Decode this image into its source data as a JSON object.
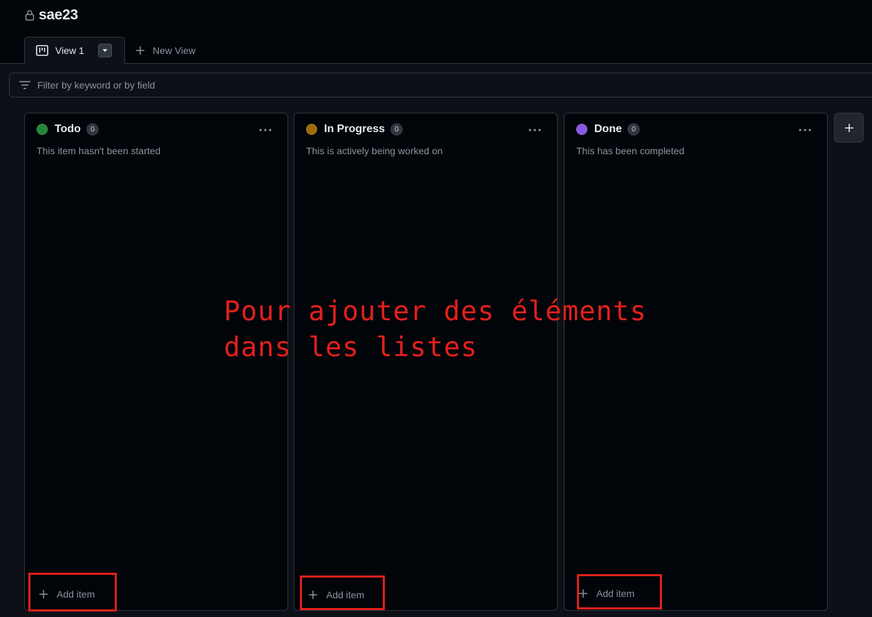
{
  "project": {
    "title": "sae23",
    "lock_icon": "lock-icon"
  },
  "tabs": {
    "active_label": "View 1",
    "active_icon": "board-icon",
    "new_label": "New View"
  },
  "filter": {
    "placeholder": "Filter by keyword or by field",
    "icon": "filter-icon"
  },
  "columns": [
    {
      "name": "Todo",
      "count": "0",
      "color": "#238636",
      "description": "This item hasn't been started",
      "add_label": "Add item"
    },
    {
      "name": "In Progress",
      "count": "0",
      "color": "#9e6a03",
      "description": "This is actively being worked on",
      "add_label": "Add item"
    },
    {
      "name": "Done",
      "count": "0",
      "color": "#8957e5",
      "description": "This has been completed",
      "add_label": "Add item"
    }
  ],
  "annotation": {
    "text": "Pour ajouter des éléments\ndans les listes",
    "color": "#e3201b"
  }
}
